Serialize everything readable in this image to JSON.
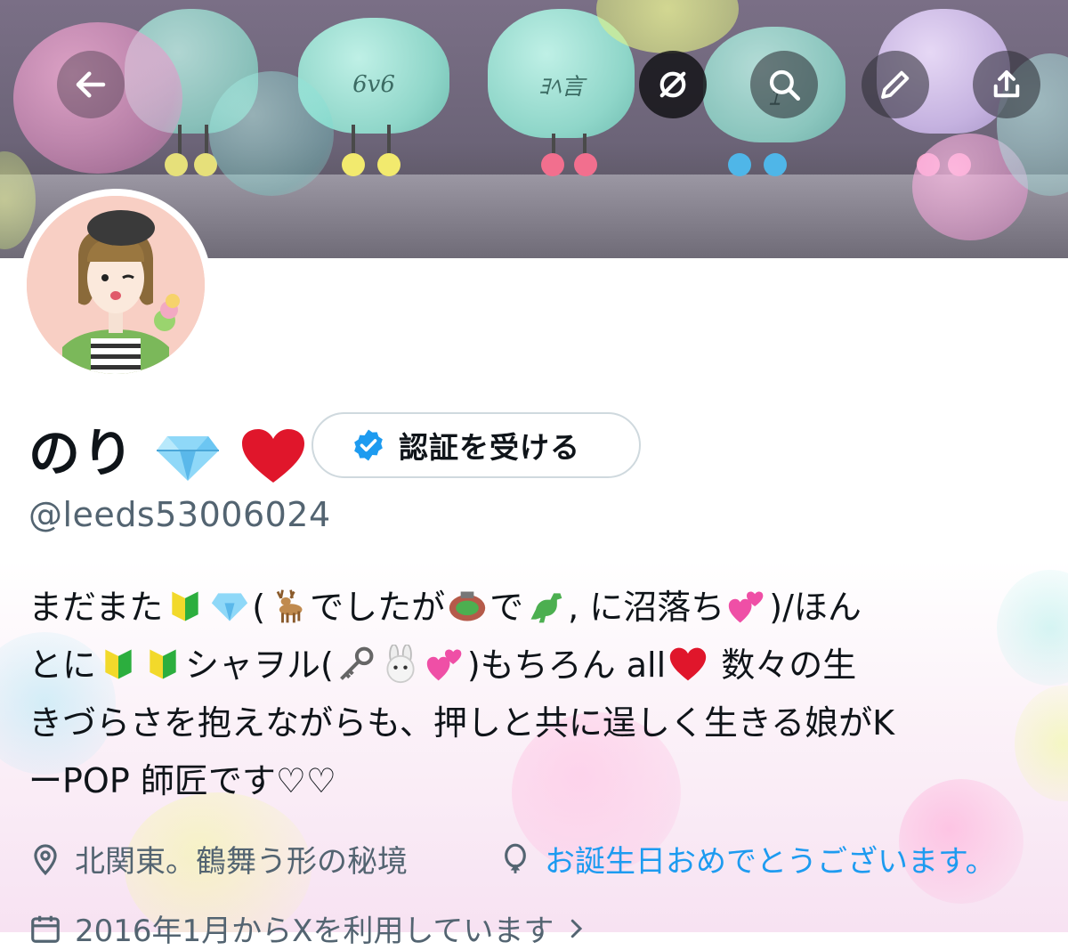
{
  "header": {
    "back_label": "←",
    "icons": [
      "grok-icon",
      "search-icon",
      "edit-icon",
      "share-icon"
    ],
    "banner_plush_texts": [
      "6v6",
      "ﾖﾍ言",
      "ｴ"
    ]
  },
  "profile": {
    "display_name": "のり",
    "name_emojis": [
      "gem-emoji",
      "heart-emoji"
    ],
    "verify_button_label": "認証を受ける",
    "handle": "@leeds53006024",
    "bio": {
      "line1_a": "まだまた",
      "line1_b": "(",
      "line1_c": "でしたが",
      "line1_d": "で",
      "line1_e": ", に沼落ち",
      "line1_f": ")/ほん",
      "line2_a": "とに",
      "line2_b": "シャヲル(",
      "line2_c": ")もちろん all",
      "line2_d": " 数々の生",
      "line3": "きづらさを抱えながらも、押しと共に逞しく生きる娘がK",
      "line4": "ーPOP 師匠です♡♡"
    },
    "location": "北関東。鶴舞う形の秘境",
    "birthday": "お誕生日おめでとうございます。",
    "joined": "2016年1月からXを利用しています"
  },
  "colors": {
    "accent_blue": "#1d9bf0",
    "text_primary": "#0f1419",
    "text_secondary": "#536471"
  }
}
